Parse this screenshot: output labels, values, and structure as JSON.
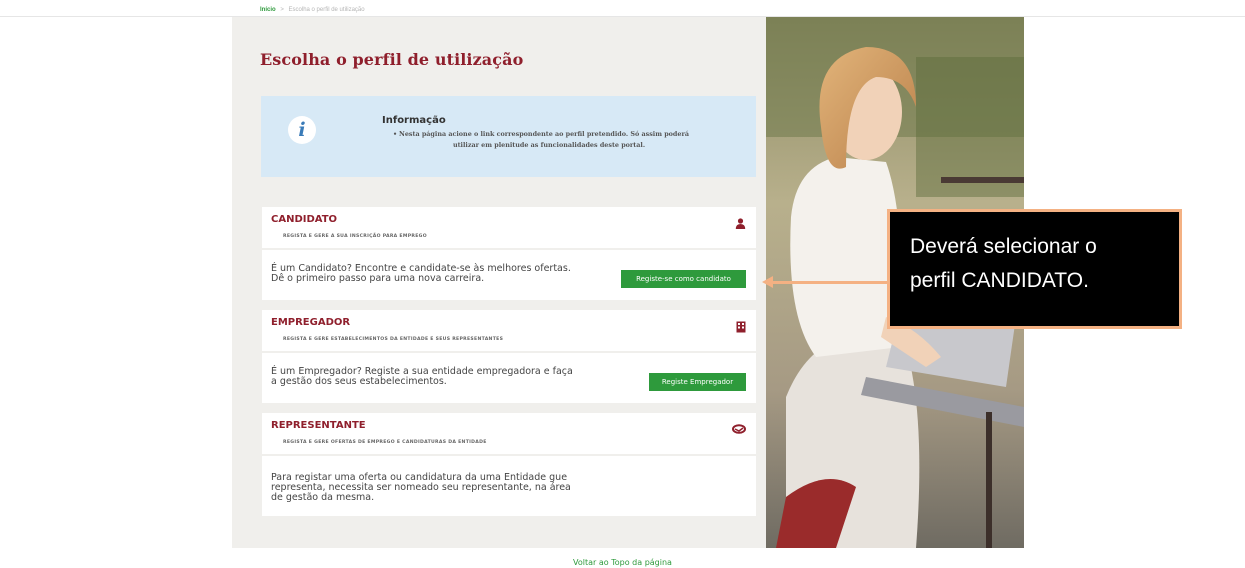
{
  "breadcrumb": {
    "home": "Início",
    "separator": ">",
    "current": "Escolha o perfil de utilização"
  },
  "page": {
    "title": "Escolha o perfil de utilização"
  },
  "info": {
    "icon": "info-icon",
    "icon_glyph": "i",
    "title": "Informação",
    "bullet": "•",
    "line1": "Nesta página acione o link correspondente ao perfil pretendido. Só assim poderá",
    "line2": "utilizar em plenitude as funcionalidades deste portal."
  },
  "cards": {
    "candidato": {
      "title": "CANDIDATO",
      "subtitle": "REGISTA E GERE A SUA INSCRIÇÃO PARA EMPREGO",
      "icon": "user-icon",
      "text_line1": "É um Candidato? Encontre e candidate-se às melhores ofertas.",
      "text_line2": "Dê o primeiro passo para uma nova carreira.",
      "button": "Registe-se como candidato"
    },
    "empregador": {
      "title": "EMPREGADOR",
      "subtitle": "REGISTA E GERE ESTABELECIMENTOS DA ENTIDADE E SEUS REPRESENTANTES",
      "icon": "building-icon",
      "text_line1": "É um Empregador? Registe a sua entidade empregadora e faça",
      "text_line2": "a gestão dos seus estabelecimentos.",
      "button": "Registe Empregador"
    },
    "representante": {
      "title": "REPRESENTANTE",
      "subtitle": "REGISTA E GERE OFERTAS DE EMPREGO E CANDIDATURAS DA ENTIDADE",
      "icon": "handshake-icon",
      "text_line1": "Para registar uma oferta ou candidatura da uma Entidade gue",
      "text_line2": "representa, necessita ser nomeado seu representante, na área",
      "text_line3": "de gestão da mesma."
    }
  },
  "callout": {
    "line1": "Deverá selecionar o",
    "line2": "perfil CANDIDATO."
  },
  "footer": {
    "back_to_top": "Voltar ao Topo da página"
  },
  "colors": {
    "brand_red": "#8f1f2c",
    "button_green": "#2e9a3c",
    "info_bg": "#d7e9f6",
    "callout_border": "#f4b183"
  }
}
